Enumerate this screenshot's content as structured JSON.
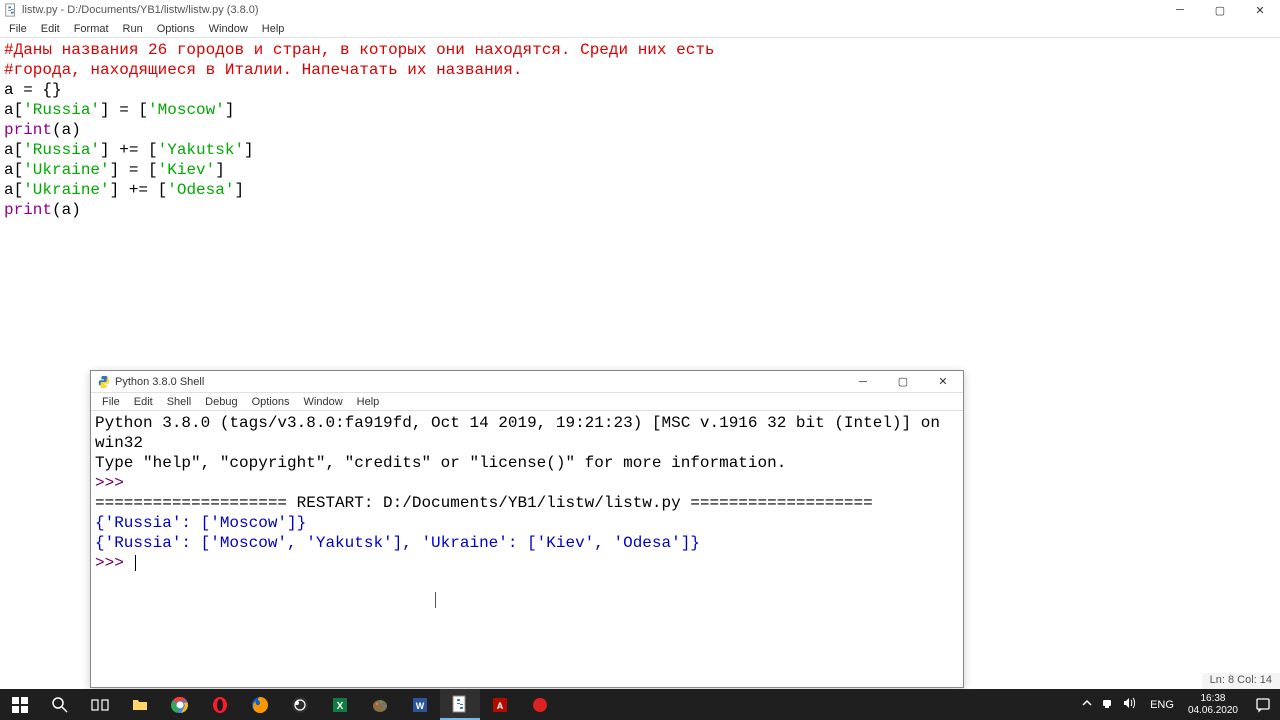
{
  "editor": {
    "title": "listw.py - D:/Documents/YB1/listw/listw.py (3.8.0)",
    "menu": [
      "File",
      "Edit",
      "Format",
      "Run",
      "Options",
      "Window",
      "Help"
    ],
    "lines": [
      {
        "t": "comment",
        "txt": "#Даны названия 26 городов и стран, в которых они находятся. Среди них есть"
      },
      {
        "t": "comment",
        "txt": "#города, находящиеся в Италии. Напечатать их названия."
      },
      {
        "segs": [
          {
            "c": "",
            "v": "a = {}"
          }
        ]
      },
      {
        "segs": [
          {
            "c": "",
            "v": "a["
          },
          {
            "c": "str",
            "v": "'Russia'"
          },
          {
            "c": "",
            "v": "] = ["
          },
          {
            "c": "str",
            "v": "'Moscow'"
          },
          {
            "c": "",
            "v": "]"
          }
        ]
      },
      {
        "segs": [
          {
            "c": "builtin",
            "v": "print"
          },
          {
            "c": "",
            "v": "(a)"
          }
        ]
      },
      {
        "segs": [
          {
            "c": "",
            "v": "a["
          },
          {
            "c": "str",
            "v": "'Russia'"
          },
          {
            "c": "",
            "v": "] += ["
          },
          {
            "c": "str",
            "v": "'Yakutsk'"
          },
          {
            "c": "",
            "v": "]"
          }
        ]
      },
      {
        "segs": [
          {
            "c": "",
            "v": "a["
          },
          {
            "c": "str",
            "v": "'Ukraine'"
          },
          {
            "c": "",
            "v": "] = ["
          },
          {
            "c": "str",
            "v": "'Kiev'"
          },
          {
            "c": "",
            "v": "]"
          }
        ]
      },
      {
        "segs": [
          {
            "c": "",
            "v": "a["
          },
          {
            "c": "str",
            "v": "'Ukraine'"
          },
          {
            "c": "",
            "v": "] += ["
          },
          {
            "c": "str",
            "v": "'Odesa'"
          },
          {
            "c": "",
            "v": "]"
          }
        ]
      },
      {
        "segs": [
          {
            "c": "builtin",
            "v": "print"
          },
          {
            "c": "",
            "v": "(a)"
          }
        ]
      }
    ],
    "status": "Ln: 8   Col: 14"
  },
  "shell": {
    "title": "Python 3.8.0 Shell",
    "menu": [
      "File",
      "Edit",
      "Shell",
      "Debug",
      "Options",
      "Window",
      "Help"
    ],
    "banner1": "Python 3.8.0 (tags/v3.8.0:fa919fd, Oct 14 2019, 19:21:23) [MSC v.1916 32 bit (Intel)] on win32",
    "banner2": "Type \"help\", \"copyright\", \"credits\" or \"license()\" for more information.",
    "prompt": ">>> ",
    "restart": "==================== RESTART: D:/Documents/YB1/listw/listw.py ===================",
    "out1": "{'Russia': ['Moscow']}",
    "out2": "{'Russia': ['Moscow', 'Yakutsk'], 'Ukraine': ['Kiev', 'Odesa']}"
  },
  "taskbar": {
    "lang": "ENG",
    "time": "16:38",
    "date": "04.06.2020"
  }
}
